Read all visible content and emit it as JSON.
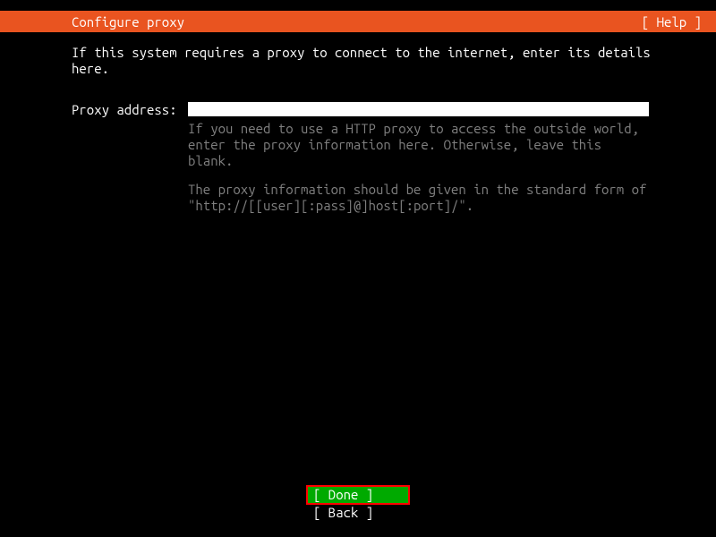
{
  "header": {
    "title": "Configure proxy",
    "help": "[ Help ]"
  },
  "content": {
    "description": "If this system requires a proxy to connect to the internet, enter its details here.",
    "form": {
      "label": "Proxy address:",
      "value": "",
      "help_line1": "If you need to use a HTTP proxy to access the outside world, enter the proxy information here. Otherwise, leave this blank.",
      "help_line2": "The proxy information should be given in the standard form of \"http://[[user][:pass]@]host[:port]/\"."
    }
  },
  "footer": {
    "done": "[ Done       ]",
    "back": "[ Back       ]"
  }
}
